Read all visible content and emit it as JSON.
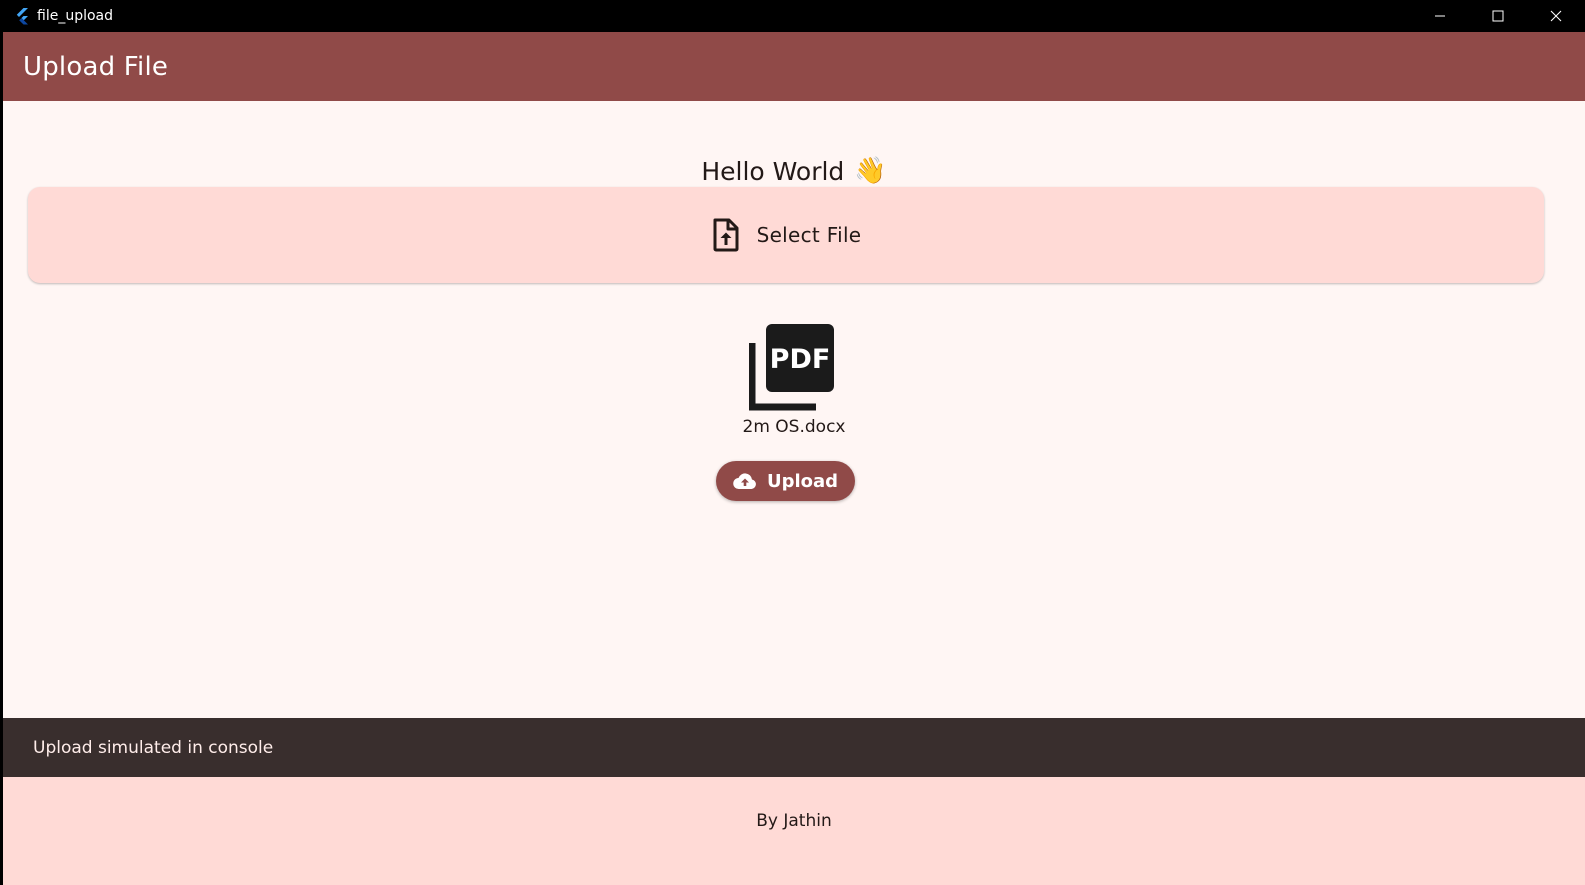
{
  "window": {
    "title": "file_upload",
    "app_icon": "flutter-logo-icon",
    "controls": [
      "minimize-icon",
      "maximize-icon",
      "close-icon"
    ]
  },
  "appbar": {
    "title": "Upload File",
    "color": "#904a48"
  },
  "greeting": {
    "text": "Hello World",
    "emoji": "👋"
  },
  "select_file": {
    "label": "Select File",
    "icon": "file-upload-icon",
    "background": "#ffdad6"
  },
  "file": {
    "icon": "pdf-file-icon",
    "icon_text": "PDF",
    "name": "2m OS.docx"
  },
  "upload_button": {
    "label": "Upload",
    "icon": "cloud-upload-icon"
  },
  "snackbar": {
    "message": "Upload simulated in console"
  },
  "footer": {
    "text": "By Jathin"
  }
}
